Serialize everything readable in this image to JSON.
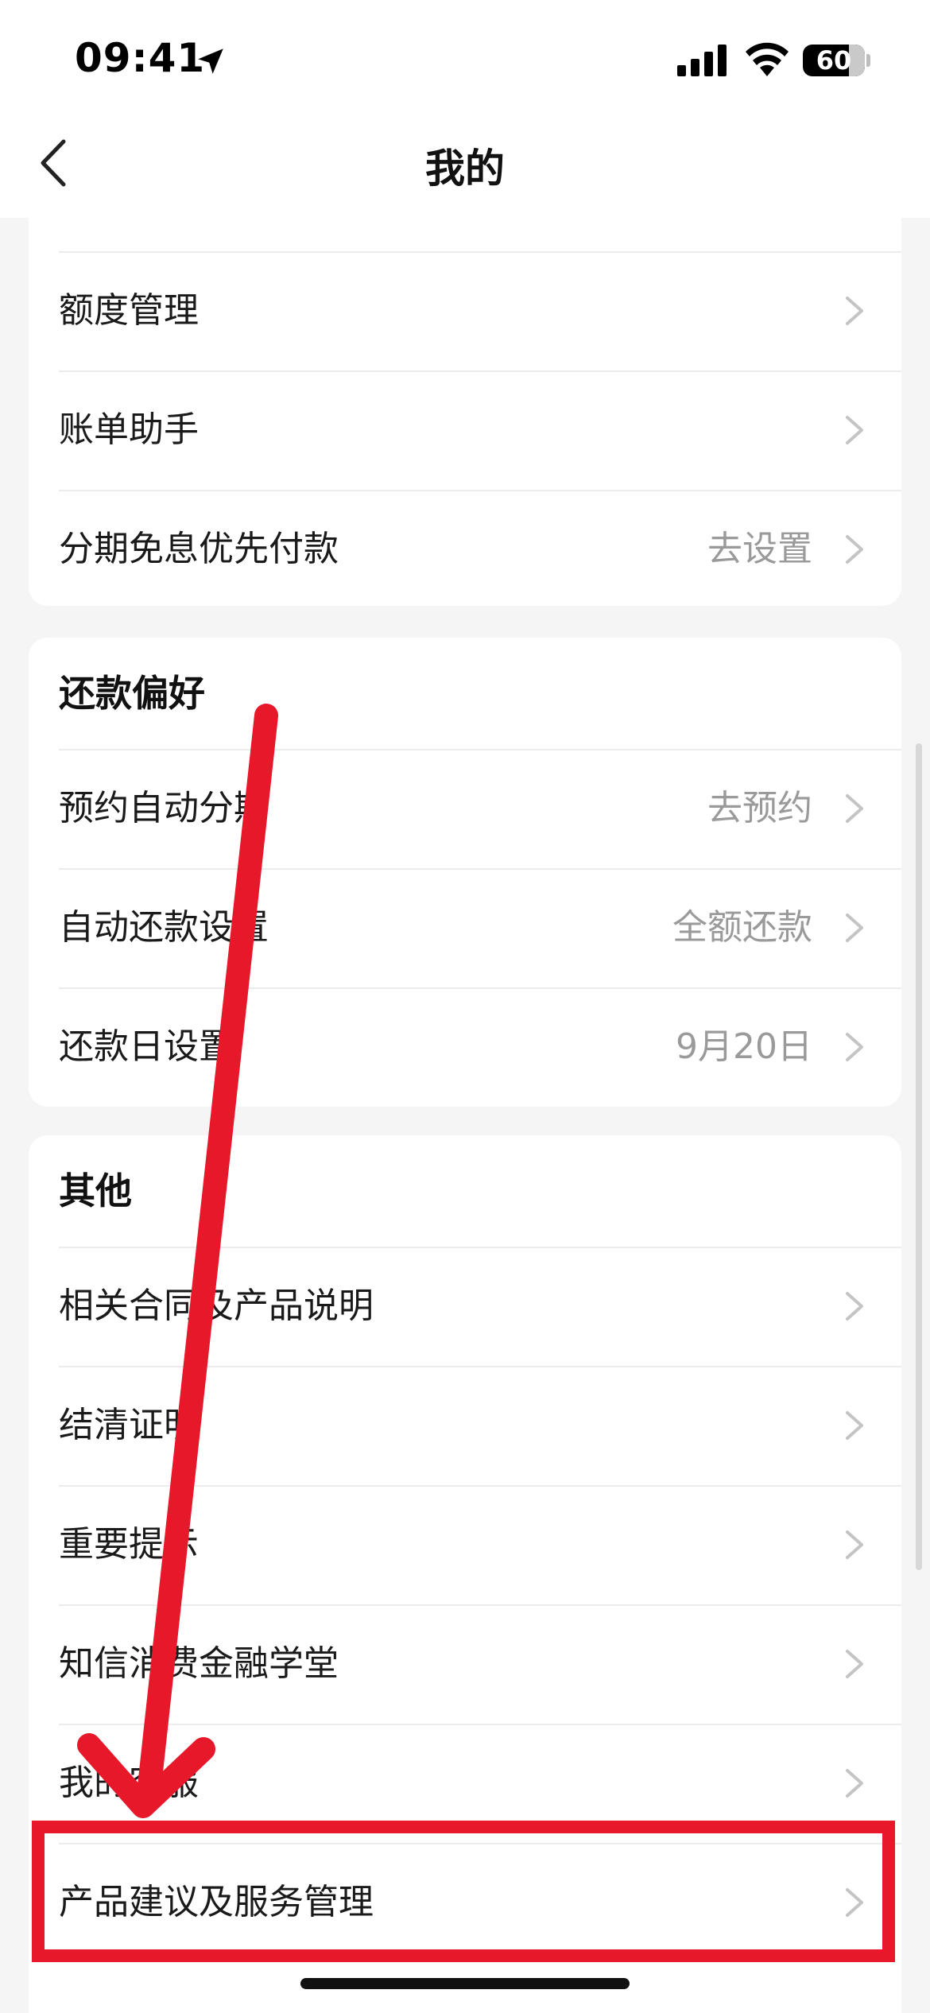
{
  "status_bar": {
    "time": "09:41",
    "battery": "60"
  },
  "nav": {
    "title": "我的"
  },
  "card_account": {
    "items": [
      {
        "label": "额度管理",
        "value": ""
      },
      {
        "label": "账单助手",
        "value": ""
      },
      {
        "label": "分期免息优先付款",
        "value": "去设置"
      }
    ]
  },
  "card_repayment": {
    "title": "还款偏好",
    "items": [
      {
        "label": "预约自动分期",
        "value": "去预约"
      },
      {
        "label": "自动还款设置",
        "value": "全额还款"
      },
      {
        "label": "还款日设置",
        "value": "9月20日"
      }
    ]
  },
  "card_other": {
    "title": "其他",
    "items": [
      {
        "label": "相关合同及产品说明",
        "value": ""
      },
      {
        "label": "结清证明",
        "value": ""
      },
      {
        "label": "重要提示",
        "value": ""
      },
      {
        "label": "知信消费金融学堂",
        "value": ""
      },
      {
        "label": "我的客服",
        "value": ""
      },
      {
        "label": "产品建议及服务管理",
        "value": ""
      }
    ]
  },
  "annotation": {
    "color": "#e8182b"
  }
}
